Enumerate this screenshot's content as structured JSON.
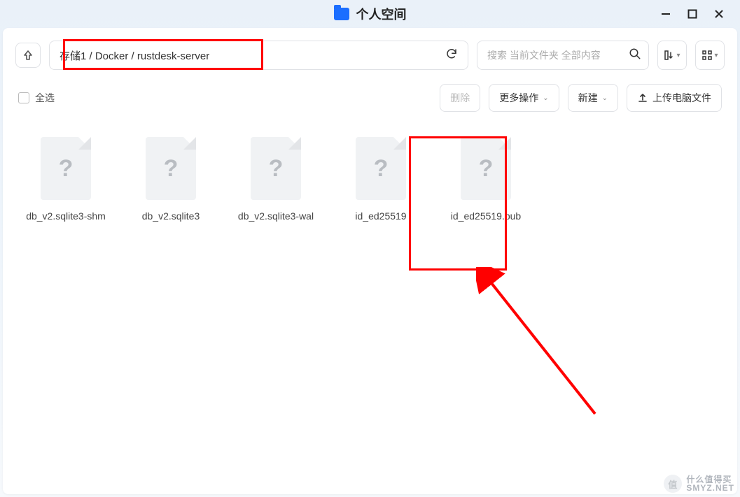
{
  "window": {
    "title": "个人空间"
  },
  "toolbar": {
    "path": "存储1 / Docker / rustdesk-server",
    "search_placeholder": "搜索 当前文件夹 全部内容"
  },
  "actions": {
    "select_all": "全选",
    "delete": "删除",
    "more_ops": "更多操作",
    "new": "新建",
    "upload": "上传电脑文件"
  },
  "files": [
    {
      "name": "db_v2.sqlite3-shm"
    },
    {
      "name": "db_v2.sqlite3"
    },
    {
      "name": "db_v2.sqlite3-wal"
    },
    {
      "name": "id_ed25519"
    },
    {
      "name": "id_ed25519.pub"
    }
  ],
  "watermark": {
    "badge": "值",
    "text1": "什么值得买",
    "text2": "SMYZ.NET"
  }
}
